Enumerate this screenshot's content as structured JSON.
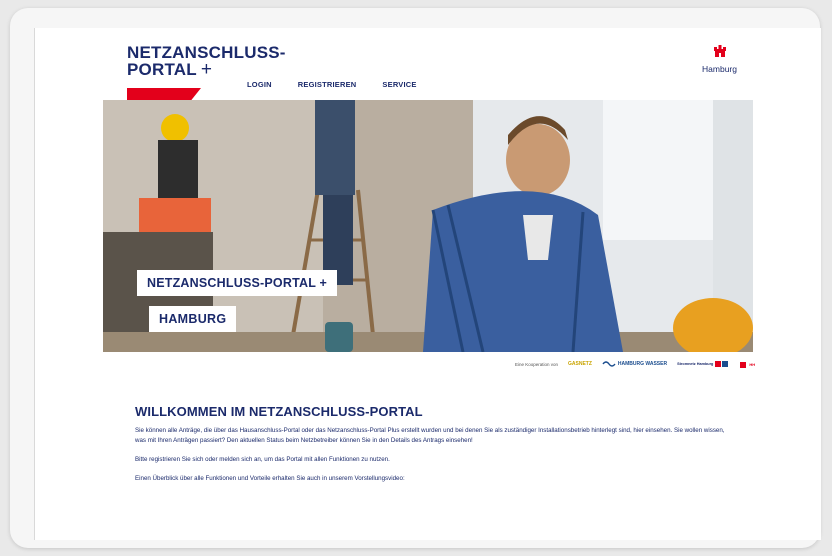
{
  "header": {
    "logo_line1": "NETZANSCHLUSS-",
    "logo_line2": "PORTAL",
    "logo_plus": "+",
    "nav": [
      "LOGIN",
      "REGISTRIEREN",
      "SERVICE"
    ],
    "city_logo": "Hamburg"
  },
  "hero": {
    "title": "NETZANSCHLUSS-PORTAL +",
    "subtitle": "HAMBURG"
  },
  "partners": {
    "intro": "Eine Kooperation von",
    "items": [
      "GASNETZ",
      "HAMBURG WASSER",
      "Stromnetz Hamburg",
      "",
      "HH"
    ]
  },
  "main": {
    "heading": "WILLKOMMEN IM NETZANSCHLUSS-PORTAL",
    "paragraphs": [
      "Sie können alle Anträge, die über das Hausanschluss-Portal oder das Netzanschluss-Portal Plus erstellt wurden und bei denen Sie als zuständiger Installationsbetrieb hinterlegt sind, hier einsehen. Sie wollen wissen, was mit Ihren Anträgen passiert? Den aktuellen Status beim Netzbetreiber können Sie in den Details des Antrags einsehen!",
      "Bitte registrieren Sie sich oder melden sich an, um das Portal mit allen Funktionen zu nutzen.",
      "Einen Überblick über alle Funktionen und Vorteile erhalten Sie auch in unserem Vorstellungsvideo:"
    ]
  },
  "colors": {
    "brand_blue": "#1b2a6b",
    "accent_red": "#e3001b"
  }
}
